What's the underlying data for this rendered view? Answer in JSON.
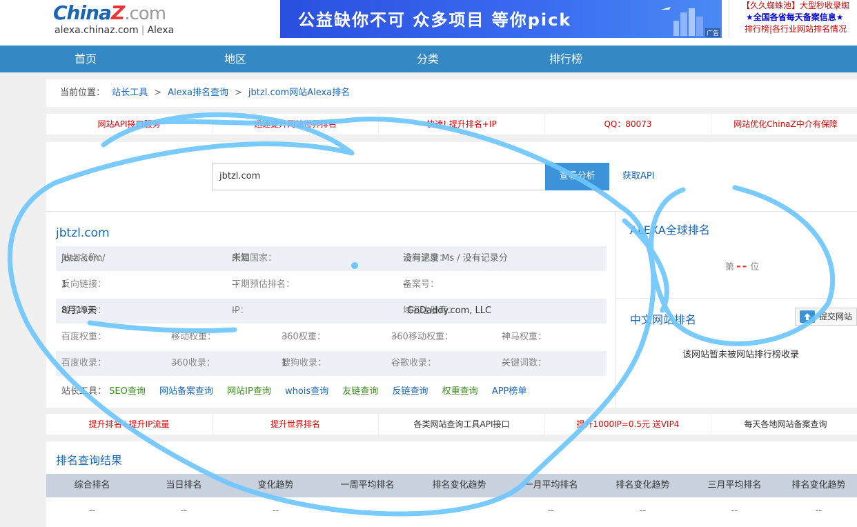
{
  "header": {
    "logo_main": "China",
    "logo_z": "Z",
    "logo_dot": ".com",
    "logo_sub_site": "alexa.chinaz.com",
    "logo_sub_sep": "|",
    "logo_sub_name": "Alexa",
    "banner_text": "公益缺你不可  众多项目  等你pick",
    "banner_ad": "广告",
    "news": [
      "【久久蜘蛛池】大型秒收录蜘",
      "★全国各省每天备案信息★",
      "排行榜|各行业网站排名情况"
    ]
  },
  "nav": [
    "首页",
    "地区",
    "分类",
    "排行榜"
  ],
  "breadcrumb": {
    "label": "当前位置：",
    "items": [
      "站长工具",
      "Alexa排名查询",
      "jbtzl.com网站Alexa排名"
    ],
    "arrow": ">"
  },
  "strip1": [
    "网站API接口服务",
    "迅速提升网站世界排名",
    "快速! 提升排名+IP",
    "QQ：80073",
    "网站优化ChinaZ中介有保障"
  ],
  "search": {
    "value": "jbtzl.com",
    "button": "查看分析",
    "api_link": "获取API"
  },
  "site": {
    "title": "jbtzl.com",
    "name_k": "站点名称：",
    "name_v": "jbtzl.com/",
    "country_k": "所属国家：",
    "country_v": "未知",
    "speed_k": "访问速度：",
    "speed_v": "没有记录 Ms / 没有记录分",
    "backlink_k": "反向链接：",
    "backlink_v": "1",
    "next_rank_k": "下期预估排名：",
    "next_rank_v": "--",
    "icp_k": "备案号：",
    "icp_v": "--",
    "age_k": "域名年龄：",
    "age_v": "8月19天",
    "ip_k": "IP：",
    "ip_v": "--",
    "registrar_k": "域名注册商：",
    "registrar_v": "GoDaddy.com, LLC",
    "bd_weight_k": "百度权重：",
    "bd_weight_v": "--",
    "mobile_weight_k": "移动权重：",
    "mobile_weight_v": "--",
    "w360_k": "360权重：",
    "w360_v": "--",
    "w360m_k": "360移动权重：",
    "w360m_v": "--",
    "sm_k": "神马权重：",
    "sm_v": "--",
    "bd_index_k": "百度收录：",
    "bd_index_v": "--",
    "i360_k": "360收录：",
    "i360_v": "--",
    "sogou_k": "搜狗收录：",
    "sogou_v": "1",
    "google_k": "谷歌收录：",
    "google_v": "--",
    "kw_k": "关键词数：",
    "kw_v": "--"
  },
  "tools": {
    "label": "站长工具：",
    "links": [
      "SEO查询",
      "网站备案查询",
      "网站IP查询",
      "whois查询",
      "友链查询",
      "反链查询",
      "权重查询",
      "APP榜单"
    ]
  },
  "alexa": {
    "title": "ALEXA全球排名",
    "prefix": "第",
    "value": "--",
    "suffix": "位"
  },
  "cn_rank": {
    "title": "中文网站排名",
    "submit": "提交网站",
    "empty": "该网站暂未被网站排行榜收录"
  },
  "strip2": [
    "提升排名+提升IP流量",
    "提升世界排名",
    "各类网站查询工具API接口",
    "提升1000IP=0.5元 送VIP4",
    "每天各地网站备案查询"
  ],
  "results": {
    "title": "排名查询结果",
    "headers": [
      "综合排名",
      "当日排名",
      "变化趋势",
      "一周平均排名",
      "排名变化趋势",
      "一月平均排名",
      "排名变化趋势",
      "三月平均排名",
      "排名变化趋势"
    ],
    "row": [
      "--",
      "--",
      "--",
      "--",
      "--",
      "--",
      "--",
      "--",
      "--"
    ]
  },
  "colors": {
    "nav": "#3489c5",
    "link": "#1a66b3",
    "annotation": "#6ec6ff"
  }
}
